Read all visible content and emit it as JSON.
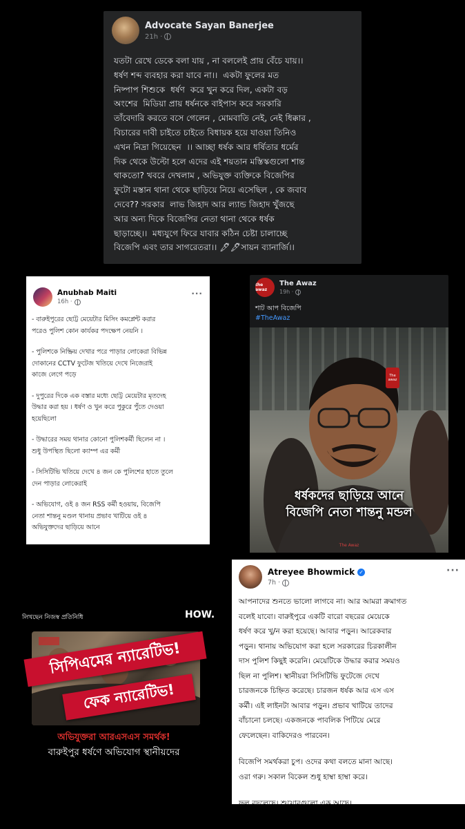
{
  "post1": {
    "author": "Advocate Sayan Banerjee",
    "time": "21h ·",
    "body": "যতটা রেখে ডেকে বলা যায় , না বললেই প্রায় বেঁচে যায়।।\nধর্ষণ শব্দ ব্যবহার করা যাবে না।।  একটা ফুলের মত\nনিষ্পাপ শিশুকে  ধর্ষণ  করে খুন করে দিল, একটা বড়\nঅংশের  মিডিয়া প্রায় ধর্ষনকে বাইপাস করে সরকারি\nতাঁবেদারি করতে বসে গেলেন , মোমবাতি নেই, নেই ধিক্কার ,\nবিচারের দাবী চাইতে চাইতে বিধায়ক হয়ে যাওয়া তিনিও\nএখন নিদ্রা গিয়েছেন  ।। আচ্ছা ধর্ষক আর ধর্ষিতার ধর্মের\nদিক থেকে উল্টো হলে এদের এই শয়তান মস্তিস্কগুলো শান্ত\nথাকতো? খবরে দেখলাম , অভিযুক্ত ব্যক্তিকে বিজেপির\nফুটো মস্তান থানা থেকে ছাড়িয়ে নিয়ে এসেছিল , কে জবাব\nদেবে?? সরকার  লাভ জিহাদ আর ল্যান্ড জিহাদ খুঁজছে\nআর অন্য দিকে বিজেপির নেতা থানা থেকে ধর্ষক\nছাড়াচ্ছে।।  মধ্যযুগে ফিরে যাবার কঠিন চেষ্টা চালাচ্ছে\nবিজেপি এবং তার সাগরেতরা।। 🖋🖋সায়ন ব্যানার্জি।।"
  },
  "post2": {
    "author": "Anubhab Maiti",
    "time": "16h ·",
    "menu": "···",
    "bullets": [
      "- বারুইপুরের ছোট্ট মেয়েটার মিসিং কমপ্লেন্ট করার\nপরেও পুলিশ কোন কার্যকর পদক্ষেপ নেয়নি ।",
      "- পুলিশকে নিষ্ক্রিয় দেখার পরে পাড়ার লোকেরা বিভিন্ন\nদোকানের CCTV ফুটেজ খতিয়ে দেখে নিজেরাই\nকাজে লেগে পড়ে",
      "- দুপুরের দিকে এক বস্তার মধ্যে ছোট্ট মেয়েটার মৃতদেহ\nউদ্ধার করা হয় । ধর্ষণ ও খুন করে পুকুরে পুঁতে দেওয়া\nহয়েছিলো",
      "- উদ্ধারের সময় থানার কোনো পুলিশকর্মী ছিলেন না ।\nশুধু উপস্থিত ছিলো ক্যাম্প এর কর্মী",
      "- সিসিটিভি খতিয়ে দেখে ৪ জন কে পুলিশের হাতে তুলে\nদেন পাড়ার লোকেরাই",
      "- অভিযোগ, ওই ৪ জন RSS কর্মী হওয়ায়, বিজেপি\nনেতা শান্তনু মণ্ডল থানায় প্রভাব খাটিয়ে ওই ৪\nঅভিযুক্তদের ছাড়িয়ে আনে"
    ]
  },
  "post3": {
    "page_name": "The Awaz",
    "logo_text": "the awaz",
    "time": "19h ·",
    "caption": "শাট আপ বিজেপি",
    "hashtag": "#TheAwaz",
    "overlay_line1": "ধর্ষকদের ছাড়িয়ে আনে",
    "overlay_line2": "বিজেপি নেতা শান্তনু মন্ডল",
    "watermark": "The Awaz",
    "mic_text": "The awaz"
  },
  "post4": {
    "author": "Atreyee Bhowmick",
    "time": "7h ·",
    "menu": "···",
    "paragraphs": [
      "আপনাদের শুনতে ভালো লাগবে না। আর আমরা ক্রমাগত\nবলেই যাবো। বারুইপুরে একটি বারো বছরের মেয়েকে\nধর্ষণ করে খু/ন করা হয়েছে। আবার পড়ুন। আরেকবার\nপড়ুন। থানায় অভিযোগ করা হলে সরকারের চিরকালীন\nদাস পুলিশ কিছুই করেনি। মেয়েটিকে উদ্ধার করার সময়ও\nছিল না পুলিশ। স্থানীয়রা সিসিটিভি ফুটেজে দেখে\nচারজনকে চিহ্নিত করেছে। চারজন ধর্ষক আর এস এস\nকর্মী। এই লাইনটা আবার পড়ুন। প্রভাব খাটিয়ে তাদের\nবাঁচানো চলছে। একজনকে পাবলিক পিটিয়ে মেরে\nফেলেছেন। বাকিদেরও পারবেন।",
      "বিজেপি সমর্থকরা চুপ। ওদের কথা বলতে মানা আছে।\nওরা গরু। সকাল বিকেল শুধু হাম্বা হাম্বা করে।",
      "ফুল বদলেছে। শুয়োরগুলো এক আছে।"
    ]
  },
  "graphic": {
    "byline": "লিখছেন  নিজস্ব প্রতিনিধি",
    "logo": "HOW.",
    "banner1": "সিপিএমের ন্যারেটিভ!",
    "banner2": "ফেক ন্যারেটিভ!",
    "subtitle_red": "অভিযুক্তরা আরএসএস সমর্থক!",
    "subtitle_white": "বারুইপুর ধর্ষণে অভিযোগ স্থানীয়দের"
  },
  "colors": {
    "fb_dark_card": "#242526",
    "fb_blue_verified": "#1877f2",
    "banner_red": "#c8102e",
    "subtitle_red": "#e0312e"
  },
  "icons": [
    "globe-icon",
    "verified-badge-icon",
    "more-options-icon"
  ]
}
